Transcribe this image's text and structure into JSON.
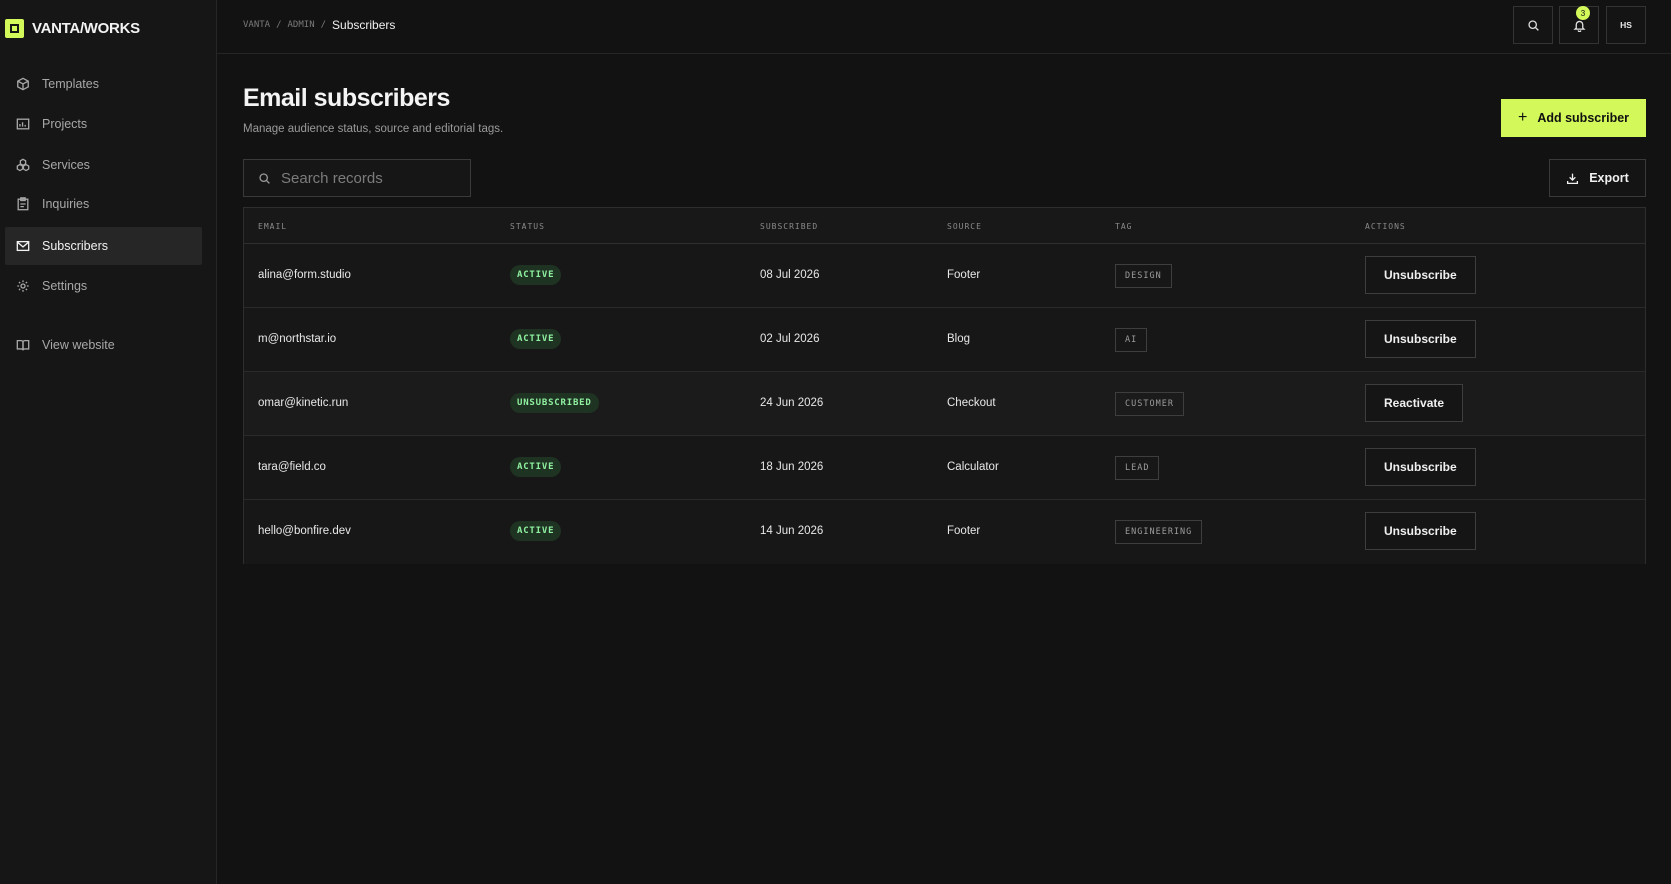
{
  "brand": {
    "name": "VANTA/WORKS"
  },
  "sidebar": {
    "items": [
      {
        "label": "Templates",
        "icon": "cube-icon"
      },
      {
        "label": "Projects",
        "icon": "calendar-chart-icon"
      },
      {
        "label": "Services",
        "icon": "cubes-icon"
      },
      {
        "label": "Inquiries",
        "icon": "clipboard-icon"
      },
      {
        "label": "Subscribers",
        "icon": "mail-icon",
        "active": true
      },
      {
        "label": "Settings",
        "icon": "gear-icon"
      }
    ],
    "view_website": "View website"
  },
  "breadcrumb": {
    "items": [
      "VANTA",
      "ADMIN"
    ],
    "separator": "/",
    "current": "Subscribers"
  },
  "topbar": {
    "notification_count": "3",
    "avatar_initials": "HS"
  },
  "page": {
    "title": "Email subscribers",
    "subtitle": "Manage audience status, source and editorial tags.",
    "add_button": "Add subscriber",
    "export_button": "Export"
  },
  "search": {
    "placeholder": "Search records",
    "value": ""
  },
  "table": {
    "columns": [
      "EMAIL",
      "STATUS",
      "SUBSCRIBED",
      "SOURCE",
      "TAG",
      "ACTIONS"
    ],
    "rows": [
      {
        "email": "alina@form.studio",
        "status": "ACTIVE",
        "subscribed": "08 Jul 2026",
        "source": "Footer",
        "tag": "DESIGN",
        "action": "Unsubscribe"
      },
      {
        "email": "m@northstar.io",
        "status": "ACTIVE",
        "subscribed": "02 Jul 2026",
        "source": "Blog",
        "tag": "AI",
        "action": "Unsubscribe"
      },
      {
        "email": "omar@kinetic.run",
        "status": "UNSUBSCRIBED",
        "subscribed": "24 Jun 2026",
        "source": "Checkout",
        "tag": "CUSTOMER",
        "action": "Reactivate"
      },
      {
        "email": "tara@field.co",
        "status": "ACTIVE",
        "subscribed": "18 Jun 2026",
        "source": "Calculator",
        "tag": "LEAD",
        "action": "Unsubscribe"
      },
      {
        "email": "hello@bonfire.dev",
        "status": "ACTIVE",
        "subscribed": "14 Jun 2026",
        "source": "Footer",
        "tag": "ENGINEERING",
        "action": "Unsubscribe"
      }
    ]
  },
  "colors": {
    "accent": "#d3f85a",
    "background": "#121212",
    "status_active_text": "#8ff0a0"
  }
}
